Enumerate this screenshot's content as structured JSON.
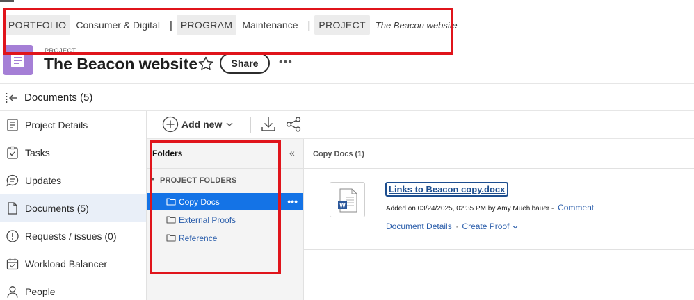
{
  "breadcrumb": {
    "portfolio_tag": "PORTFOLIO",
    "portfolio_value": "Consumer & Digital",
    "program_tag": "PROGRAM",
    "program_value": "Maintenance",
    "project_tag": "PROJECT",
    "project_value": "The Beacon website",
    "separator": "|"
  },
  "header": {
    "label": "PROJECT",
    "title": "The Beacon website",
    "share_label": "Share",
    "more": "•••"
  },
  "section": {
    "title": "Documents (5)"
  },
  "sidebar": {
    "items": [
      {
        "label": "Project Details",
        "icon": "document-icon"
      },
      {
        "label": "Tasks",
        "icon": "clipboard-icon"
      },
      {
        "label": "Updates",
        "icon": "chat-icon"
      },
      {
        "label": "Documents (5)",
        "icon": "file-icon",
        "active": true
      },
      {
        "label": "Requests / issues (0)",
        "icon": "alert-icon"
      },
      {
        "label": "Workload Balancer",
        "icon": "calendar-icon"
      },
      {
        "label": "People",
        "icon": "person-icon"
      }
    ]
  },
  "toolbar": {
    "add_new_label": "Add new"
  },
  "folders": {
    "title": "Folders",
    "collapse": "«",
    "group_label": "PROJECT FOLDERS",
    "items": [
      {
        "label": "Copy Docs",
        "selected": true,
        "more": "•••"
      },
      {
        "label": "External Proofs"
      },
      {
        "label": "Reference"
      }
    ]
  },
  "content": {
    "title": "Copy Docs (1)",
    "document": {
      "name": "Links to Beacon copy.docx",
      "meta": "Added on 03/24/2025, 02:35 PM by Amy Muehlbauer -",
      "comment_label": "Comment",
      "details_label": "Document Details",
      "separator": "·",
      "proof_label": "Create Proof"
    }
  },
  "colors": {
    "accent": "#1473e6",
    "link": "#2b5eab",
    "project_icon": "#a57fd6",
    "annotation": "#e0141b"
  }
}
